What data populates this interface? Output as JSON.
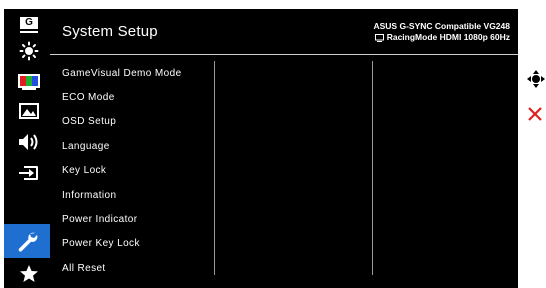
{
  "header": {
    "title": "System Setup",
    "model_line1": "ASUS G-SYNC Compatible VG248",
    "model_line2": "RacingMode HDMI 1080p 60Hz"
  },
  "menu": {
    "items": [
      {
        "label": "GameVisual Demo Mode"
      },
      {
        "label": "ECO Mode"
      },
      {
        "label": "OSD Setup"
      },
      {
        "label": "Language"
      },
      {
        "label": "Key Lock"
      },
      {
        "label": "Information"
      },
      {
        "label": "Power Indicator"
      },
      {
        "label": "Power Key Lock"
      },
      {
        "label": "All Reset"
      }
    ]
  },
  "sidebar": {
    "items": [
      {
        "icon": "gamevisual-icon",
        "glyph": "G"
      },
      {
        "icon": "brightness-icon"
      },
      {
        "icon": "color-icon"
      },
      {
        "icon": "image-icon"
      },
      {
        "icon": "sound-icon"
      },
      {
        "icon": "input-select-icon"
      },
      {
        "icon": "system-setup-icon",
        "active": true
      },
      {
        "icon": "favorite-icon"
      }
    ]
  },
  "colors": {
    "active": "#1f6fd1",
    "close": "#e02020"
  }
}
